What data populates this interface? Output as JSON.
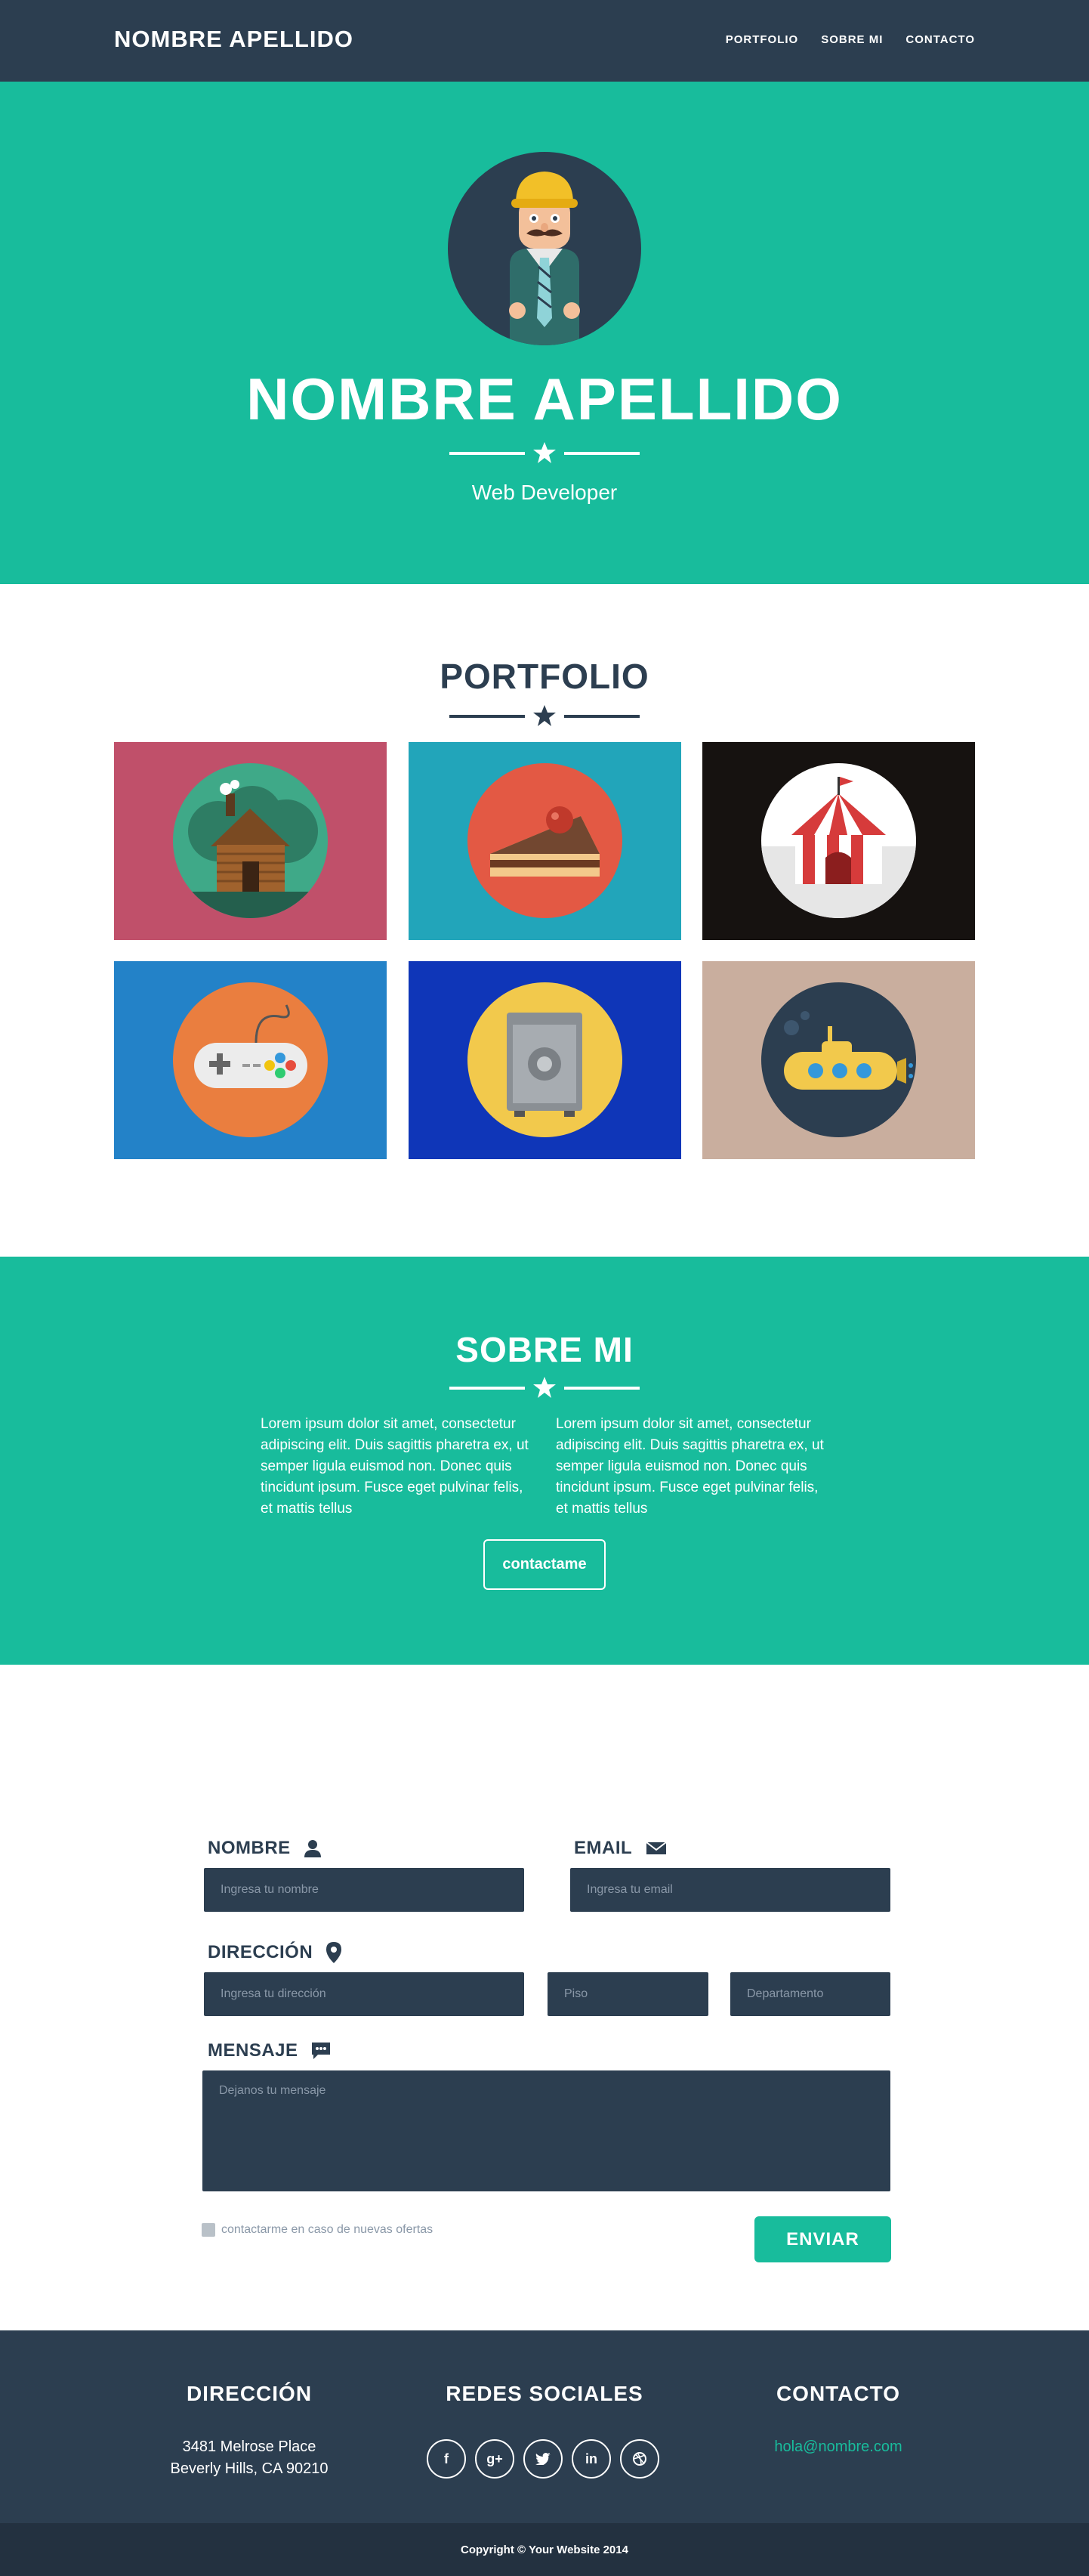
{
  "nav": {
    "brand": "NOMBRE APELLIDO",
    "links": [
      "PORTFOLIO",
      "SOBRE MI",
      "CONTACTO"
    ]
  },
  "hero": {
    "title": "NOMBRE APELLIDO",
    "subtitle": "Web Developer"
  },
  "portfolio": {
    "title": "PORTFOLIO",
    "items": [
      {
        "icon": "cabin-icon",
        "bg": "#c0506a",
        "circle": "#2f8f6f"
      },
      {
        "icon": "cake-icon",
        "bg": "#22a5ba",
        "circle": "#e35944"
      },
      {
        "icon": "circus-tent-icon",
        "bg": "#161210",
        "circle": "#ffffff"
      },
      {
        "icon": "game-controller-icon",
        "bg": "#2382c8",
        "circle": "#ea7e3f"
      },
      {
        "icon": "safe-icon",
        "bg": "#0f36b8",
        "circle": "#f2c94c"
      },
      {
        "icon": "submarine-icon",
        "bg": "#c9ae9e",
        "circle": "#2c3e50"
      }
    ]
  },
  "about": {
    "title": "SOBRE MI",
    "col1": "Lorem ipsum dolor sit amet, consectetur adipiscing elit. Duis sagittis pharetra ex, ut semper ligula euismod non. Donec quis tincidunt ipsum. Fusce eget pulvinar felis, et mattis tellus",
    "col2": "Lorem ipsum dolor sit amet, consectetur adipiscing elit. Duis sagittis pharetra ex, ut semper ligula euismod non. Donec quis tincidunt ipsum. Fusce eget pulvinar felis, et mattis tellus",
    "button": "contactame"
  },
  "form": {
    "name_label": "NOMBRE",
    "name_placeholder": "Ingresa tu nombre",
    "email_label": "EMAIL",
    "email_placeholder": "Ingresa tu email",
    "address_label": "DIRECCIÓN",
    "address_placeholder": "Ingresa tu dirección",
    "floor_placeholder": "Piso",
    "apt_placeholder": "Departamento",
    "message_label": "MENSAJE",
    "message_placeholder": "Dejanos tu mensaje",
    "checkbox_label": "contactarme en caso de nuevas ofertas",
    "submit": "ENVIAR"
  },
  "footer": {
    "address_title": "DIRECCIÓN",
    "address_line1": "3481 Melrose Place",
    "address_line2": "Beverly Hills, CA 90210",
    "social_title": "REDES SOCIALES",
    "social_icons": [
      "facebook-icon",
      "google-plus-icon",
      "twitter-icon",
      "linkedin-icon",
      "dribbble-icon"
    ],
    "contact_title": "CONTACTO",
    "contact_email": "hola@nombre.com",
    "copyright": "Copyright © Your Website 2014"
  },
  "colors": {
    "navy": "#2c3e50",
    "teal": "#18bc9c"
  }
}
